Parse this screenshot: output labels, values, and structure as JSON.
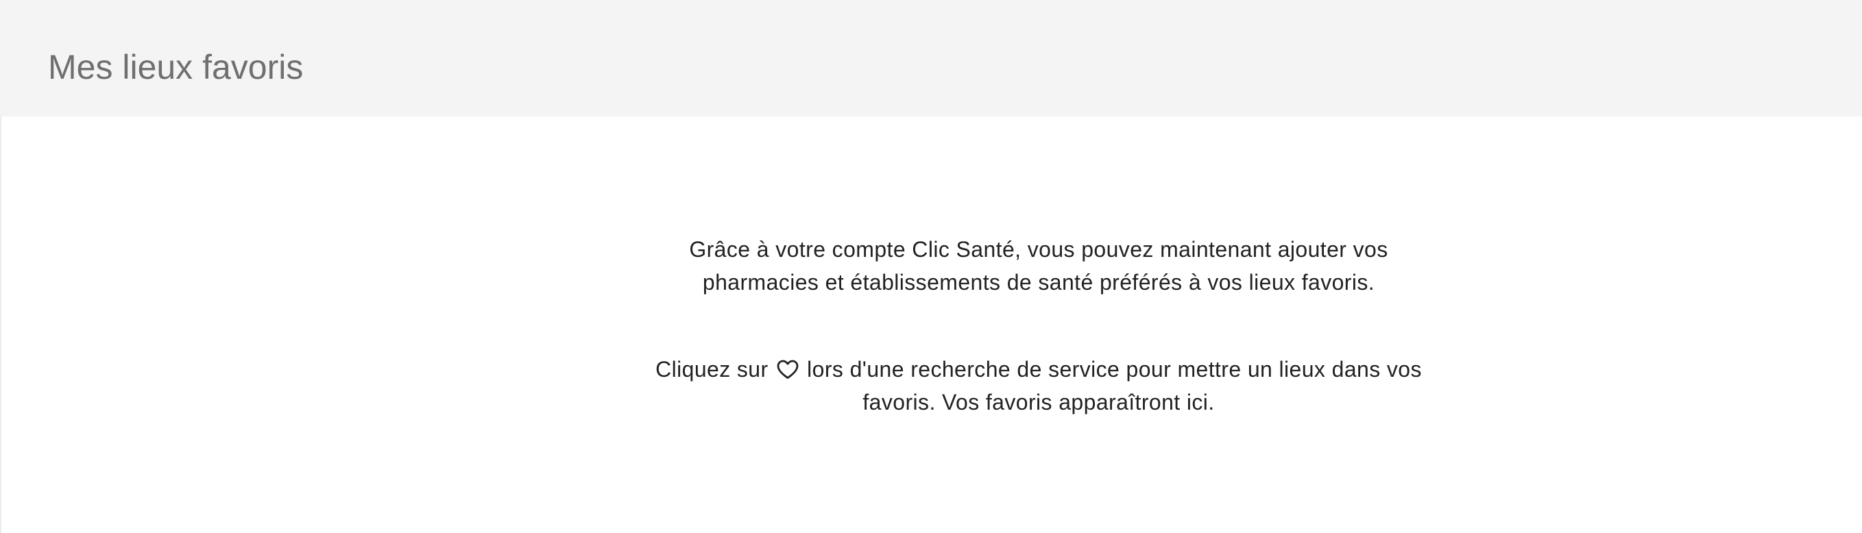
{
  "header": {
    "title": "Mes lieux favoris"
  },
  "empty_state": {
    "intro_line_1": "Grâce à votre compte Clic Santé, vous pouvez maintenant ajouter vos",
    "intro_line_2": "pharmacies et établissements de santé préférés à vos lieux favoris.",
    "instruction_prefix": "Cliquez sur",
    "instruction_icon": "heart-outline-icon",
    "instruction_suffix": "lors d'une recherche de service pour mettre un lieux dans vos",
    "instruction_line_2": "favoris. Vos favoris apparaîtront ici."
  },
  "colors": {
    "header_background": "#f4f4f4",
    "title_text": "#6f6f6f",
    "body_text": "#222222"
  }
}
